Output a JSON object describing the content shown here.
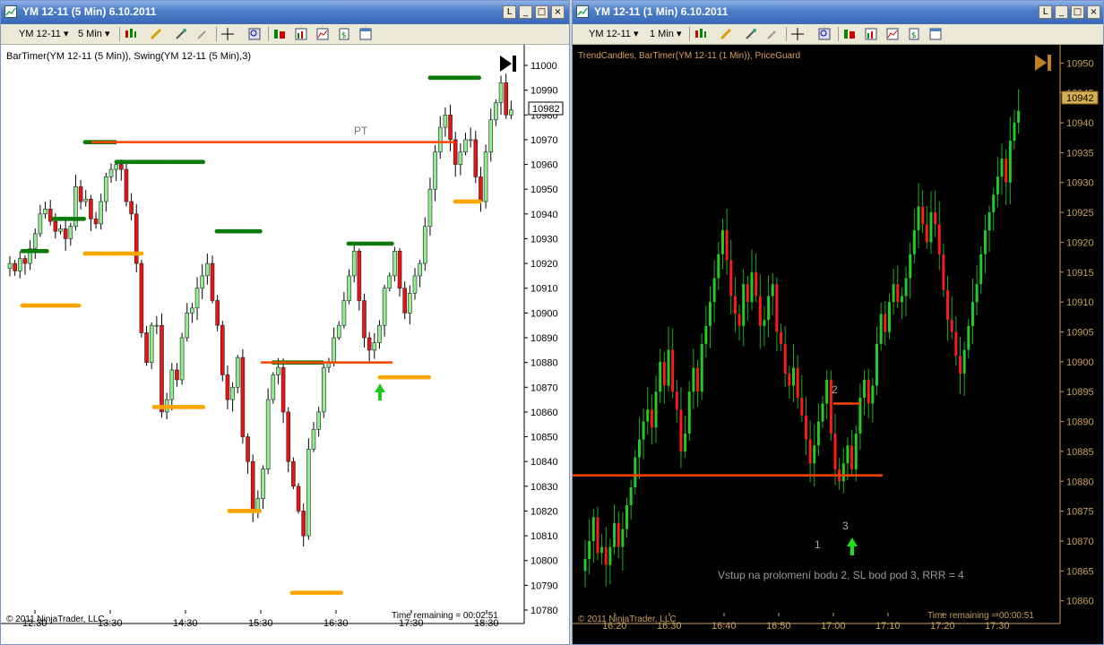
{
  "left": {
    "title": "YM 12-11 (5 Min)  6.10.2011",
    "window_buttons": [
      "L",
      "_",
      "□",
      "×"
    ],
    "toolbar": {
      "instrument": "YM 12-11",
      "interval": "5 Min"
    },
    "indicator_label": "BarTimer(YM 12-11 (5 Min)), Swing(YM 12-11 (5 Min),3)",
    "copyright": "© 2011 NinjaTrader, LLC",
    "time_remaining": "Time remaining = 00:02:51",
    "current_price": "10982",
    "annotation_pt": "PT",
    "colors": {
      "background": "#ffffff",
      "up": "#90ee90",
      "down": "#e81414",
      "swing_high": "#0a7a0a",
      "swing_low": "#ffa500",
      "level": "#ff4500"
    }
  },
  "right": {
    "title": "YM 12-11 (1 Min)  6.10.2011",
    "window_buttons": [
      "L",
      "_",
      "□",
      "×"
    ],
    "toolbar": {
      "instrument": "YM 12-11",
      "interval": "1 Min"
    },
    "indicator_label": "TrendCandles, BarTimer(YM 12-11 (1 Min)), PriceGuard",
    "copyright": "© 2011 NinjaTrader, LLC",
    "time_remaining": "Time remaining = 00:00:51",
    "current_price": "10942",
    "annotation_1": "1",
    "annotation_2": "2",
    "annotation_3": "3",
    "note": "Vstup na prolomení bodu 2, SL bod pod 3, RRR = 4",
    "colors": {
      "background": "#000000",
      "up": "#22cc22",
      "down": "#ff1a1a",
      "level": "#ff4500",
      "axis": "#c8a060"
    }
  },
  "chart_data": [
    {
      "type": "candlestick",
      "title": "YM 12-11 (5 Min)",
      "ylim": [
        10780,
        11000
      ],
      "y_ticks": [
        "10780",
        "10790",
        "10800",
        "10810",
        "10820",
        "10830",
        "10840",
        "10850",
        "10860",
        "10870",
        "10880",
        "10890",
        "10900",
        "10910",
        "10920",
        "10930",
        "10940",
        "10950",
        "10960",
        "10970",
        "10980",
        "10990",
        "11000"
      ],
      "x_ticks": [
        "12:30",
        "13:30",
        "14:30",
        "15:30",
        "16:30",
        "17:30",
        "18:30"
      ],
      "closes": [
        10920,
        10917,
        10922,
        10920,
        10926,
        10932,
        10940,
        10942,
        10937,
        10933,
        10934,
        10930,
        10935,
        10951,
        10945,
        10946,
        10938,
        10936,
        10945,
        10955,
        10958,
        10960,
        10958,
        10945,
        10940,
        10920,
        10892,
        10880,
        10895,
        10895,
        10860,
        10865,
        10877,
        10873,
        10890,
        10900,
        10902,
        10910,
        10915,
        10920,
        10905,
        10895,
        10875,
        10865,
        10870,
        10882,
        10850,
        10840,
        10820,
        10825,
        10837,
        10865,
        10875,
        10878,
        10860,
        10840,
        10830,
        10820,
        10810,
        10845,
        10853,
        10860,
        10878,
        10880,
        10890,
        10895,
        10905,
        10915,
        10925,
        10905,
        10890,
        10885,
        10888,
        10895,
        10910,
        10915,
        10925,
        10910,
        10900,
        10908,
        10915,
        10920,
        10935,
        10950,
        10965,
        10975,
        10980,
        10970,
        10960,
        10965,
        10970,
        10970,
        10955,
        10945,
        10965,
        10978,
        10985,
        10993,
        10980,
        10982
      ],
      "swing_highs": [
        {
          "y": 10925,
          "from": "12:20",
          "to": "12:40"
        },
        {
          "y": 10938,
          "from": "12:45",
          "to": "13:10"
        },
        {
          "y": 10969,
          "from": "13:10",
          "to": "13:35"
        },
        {
          "y": 10961,
          "from": "13:35",
          "to": "14:45"
        },
        {
          "y": 10933,
          "from": "14:55",
          "to": "15:30"
        },
        {
          "y": 10880,
          "from": "15:40",
          "to": "16:20"
        },
        {
          "y": 10928,
          "from": "16:40",
          "to": "17:15"
        },
        {
          "y": 10995,
          "from": "17:45",
          "to": "18:25"
        }
      ],
      "swing_lows": [
        {
          "y": 10903,
          "from": "12:20",
          "to": "13:05"
        },
        {
          "y": 10924,
          "from": "13:10",
          "to": "13:55"
        },
        {
          "y": 10862,
          "from": "14:05",
          "to": "14:45"
        },
        {
          "y": 10820,
          "from": "15:05",
          "to": "15:30"
        },
        {
          "y": 10787,
          "from": "15:55",
          "to": "16:35"
        },
        {
          "y": 10874,
          "from": "17:05",
          "to": "17:45"
        },
        {
          "y": 10945,
          "from": "18:05",
          "to": "18:25"
        }
      ],
      "levels": [
        {
          "y": 10969,
          "from": "13:15",
          "to": "18:05",
          "label": "PT"
        },
        {
          "y": 10880,
          "from": "15:30",
          "to": "17:15"
        }
      ],
      "current_price": 10982
    },
    {
      "type": "candlestick",
      "title": "YM 12-11 (1 Min)",
      "ylim": [
        10858,
        10952
      ],
      "y_ticks": [
        "10860",
        "10865",
        "10870",
        "10875",
        "10880",
        "10885",
        "10890",
        "10895",
        "10900",
        "10905",
        "10910",
        "10915",
        "10920",
        "10925",
        "10930",
        "10935",
        "10940",
        "10945",
        "10950"
      ],
      "x_ticks": [
        "16:20",
        "16:30",
        "16:40",
        "16:50",
        "17:00",
        "17:10",
        "17:20",
        "17:30"
      ],
      "closes": [
        10867,
        10870,
        10874,
        10868,
        10869,
        10866,
        10869,
        10873,
        10869,
        10872,
        10876,
        10879,
        10884,
        10887,
        10890,
        10892,
        10889,
        10895,
        10900,
        10896,
        10902,
        10895,
        10892,
        10885,
        10888,
        10895,
        10899,
        10895,
        10903,
        10906,
        10910,
        10914,
        10918,
        10922,
        10917,
        10911,
        10908,
        10906,
        10913,
        10910,
        10915,
        10911,
        10906,
        10907,
        10911,
        10913,
        10905,
        10903,
        10898,
        10896,
        10899,
        10894,
        10891,
        10887,
        10883,
        10886,
        10890,
        10893,
        10897,
        10888,
        10882,
        10880,
        10883,
        10886,
        10882,
        10888,
        10894,
        10897,
        10893,
        10896,
        10903,
        10908,
        10905,
        10910,
        10913,
        10910,
        10911,
        10914,
        10918,
        10922,
        10926,
        10923,
        10920,
        10925,
        10923,
        10918,
        10912,
        10907,
        10905,
        10901,
        10898,
        10902,
        10906,
        10910,
        10913,
        10918,
        10922,
        10925,
        10928,
        10931,
        10934,
        10930,
        10937,
        10940,
        10942
      ],
      "levels": [
        {
          "y": 10881,
          "from": "16:11",
          "to": "17:09"
        },
        {
          "y": 10893,
          "from": "17:00",
          "to": "17:05"
        }
      ],
      "current_price": 10942
    }
  ]
}
